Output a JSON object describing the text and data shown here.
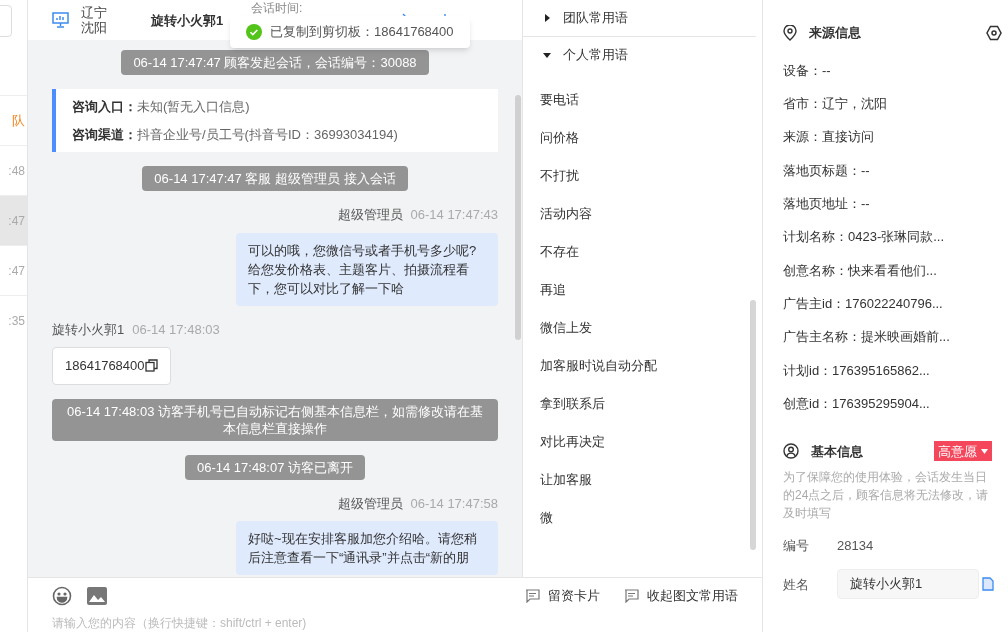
{
  "sidebar": {
    "items": [
      {
        "text": "队",
        "kind": "alert",
        "selected": false
      },
      {
        "text": ":48",
        "kind": "time",
        "selected": false
      },
      {
        "text": ":47",
        "kind": "time",
        "selected": true
      },
      {
        "text": ":47",
        "kind": "time",
        "selected": false
      },
      {
        "text": ":35",
        "kind": "time",
        "selected": false
      }
    ]
  },
  "chat_header": {
    "location": "辽宁沈阳",
    "visitor": "旋转小火郭1",
    "session_time_label": "会话时间:"
  },
  "toast": {
    "text": "已复制到剪切板：18641768400"
  },
  "messages": [
    {
      "kind": "system",
      "text": "06-14 17:47:47 顾客发起会话，会话编号：30088"
    },
    {
      "kind": "info",
      "rows": [
        {
          "label": "咨询入口：",
          "value": "未知(暂无入口信息)"
        },
        {
          "label": "咨询渠道：",
          "value": "抖音企业号/员工号(抖音号ID：36993034194)"
        }
      ]
    },
    {
      "kind": "system",
      "text": "06-14 17:47:47 客服 超级管理员 接入会话"
    },
    {
      "kind": "agent",
      "sender": "超级管理员",
      "time": "06-14 17:47:43",
      "text": "可以的哦，您微信号或者手机号多少呢?给您发价格表、主题客片、拍摄流程看下，您可以对比了解一下哈"
    },
    {
      "kind": "visitor",
      "sender": "旋转小火郭1",
      "time": "06-14 17:48:03",
      "text": "18641768400"
    },
    {
      "kind": "system",
      "text": "06-14 17:48:03 访客手机号已自动标记右侧基本信息栏，如需修改请在基本信息栏直接操作"
    },
    {
      "kind": "system",
      "text": "06-14 17:48:07 访客已离开"
    },
    {
      "kind": "agent",
      "sender": "超级管理员",
      "time": "06-14 17:47:58",
      "text": "好哒~现在安排客服加您介绍哈。请您稍后注意查看一下“通讯录”并点击“新的朋"
    }
  ],
  "phrases": {
    "groups": [
      {
        "title": "团队常用语",
        "expanded": false
      },
      {
        "title": "个人常用语",
        "expanded": true,
        "items": [
          "要电话",
          "问价格",
          "不打扰",
          "活动内容",
          "不存在",
          "再追",
          "微信上发",
          "加客服时说自动分配",
          "拿到联系后",
          "对比再决定",
          "让加客服",
          "微"
        ]
      }
    ]
  },
  "composer": {
    "actions": [
      "留资卡片",
      "收起图文常用语"
    ],
    "placeholder": "请输入您的内容（换行快捷键：shift/ctrl + enter)"
  },
  "source_info": {
    "title": "来源信息",
    "fields": [
      "设备：--",
      "省市：辽宁，沈阳",
      "来源：直接访问",
      "落地页标题：--",
      "落地页地址：--",
      "计划名称：0423-张琳同款...",
      "创意名称：快来看看他们...",
      "广告主id：176022240796...",
      "广告主名称：提米映画婚前...",
      "计划id：176395165862...",
      "创意id：176395295904..."
    ]
  },
  "basic_info": {
    "title": "基本信息",
    "intent_tag": "高意愿",
    "notice": "为了保障您的使用体验，会话发生当日的24点之后，顾客信息将无法修改，请及时填写",
    "number_label": "编号",
    "number": "28134",
    "name_label": "姓名",
    "name_value": "旋转小火郭1"
  }
}
